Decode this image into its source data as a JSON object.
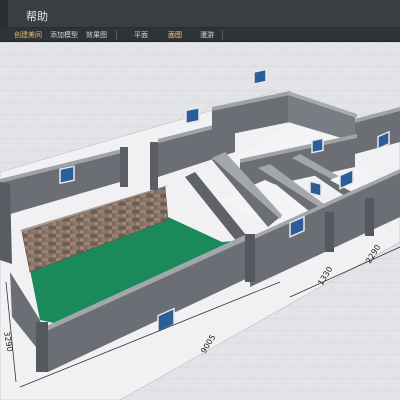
{
  "menu": {
    "help_label": "帮助"
  },
  "toolbar": {
    "items": [
      {
        "label": "创建美间"
      },
      {
        "label": "添加模型"
      },
      {
        "label": "效果图"
      },
      {
        "label": "平面"
      },
      {
        "label": "面图"
      },
      {
        "label": "漫游"
      }
    ]
  },
  "scene": {
    "dimensions": {
      "left": "3290",
      "bottom": "9005",
      "right_1": "1330",
      "right_2": "2290"
    },
    "colors": {
      "floor_green": "#1a8a5a",
      "wall_gray": "#6b6e74",
      "wall_top": "#9fa2a7",
      "window_blue": "#2d5c9a",
      "brick": "#8a7466",
      "ground": "#e6e7ea"
    }
  }
}
